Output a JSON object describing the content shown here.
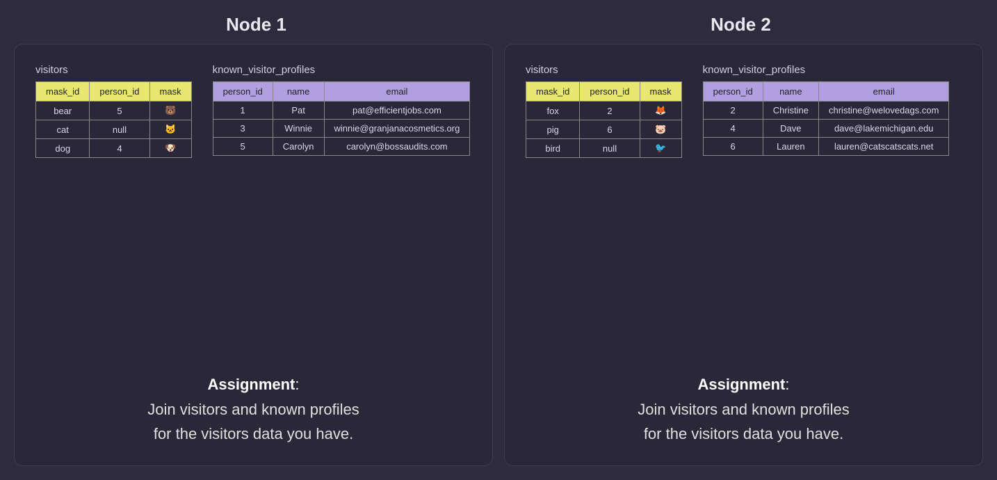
{
  "nodes": [
    {
      "title": "Node 1",
      "visitors": {
        "table_name": "visitors",
        "headers": [
          "mask_id",
          "person_id",
          "mask"
        ],
        "rows": [
          {
            "mask_id": "bear",
            "person_id": "5",
            "mask": "🐻"
          },
          {
            "mask_id": "cat",
            "person_id": "null",
            "mask": "🐱"
          },
          {
            "mask_id": "dog",
            "person_id": "4",
            "mask": "🐶"
          }
        ]
      },
      "known_visitor_profiles": {
        "table_name": "known_visitor_profiles",
        "headers": [
          "person_id",
          "name",
          "email"
        ],
        "rows": [
          {
            "person_id": "1",
            "name": "Pat",
            "email": "pat@efficientjobs.com"
          },
          {
            "person_id": "3",
            "name": "Winnie",
            "email": "winnie@granjanacosmetics.org"
          },
          {
            "person_id": "5",
            "name": "Carolyn",
            "email": "carolyn@bossaudits.com"
          }
        ]
      },
      "assignment": {
        "label": "Assignment",
        "text": "Join visitors and known profiles\nfor the visitors data you have."
      }
    },
    {
      "title": "Node 2",
      "visitors": {
        "table_name": "visitors",
        "headers": [
          "mask_id",
          "person_id",
          "mask"
        ],
        "rows": [
          {
            "mask_id": "fox",
            "person_id": "2",
            "mask": "🦊"
          },
          {
            "mask_id": "pig",
            "person_id": "6",
            "mask": "🐷"
          },
          {
            "mask_id": "bird",
            "person_id": "null",
            "mask": "🐦"
          }
        ]
      },
      "known_visitor_profiles": {
        "table_name": "known_visitor_profiles",
        "headers": [
          "person_id",
          "name",
          "email"
        ],
        "rows": [
          {
            "person_id": "2",
            "name": "Christine",
            "email": "christine@welovedags.com"
          },
          {
            "person_id": "4",
            "name": "Dave",
            "email": "dave@lakemichigan.edu"
          },
          {
            "person_id": "6",
            "name": "Lauren",
            "email": "lauren@catscatscats.net"
          }
        ]
      },
      "assignment": {
        "label": "Assignment",
        "text": "Join visitors and known profiles\nfor the visitors data you have."
      }
    }
  ]
}
